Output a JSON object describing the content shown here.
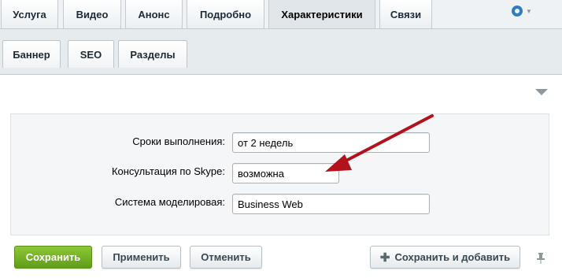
{
  "top_tabs": [
    {
      "label": "Услуга"
    },
    {
      "label": "Видео"
    },
    {
      "label": "Анонс"
    },
    {
      "label": "Подробно"
    },
    {
      "label": "Характеристики",
      "active": true
    },
    {
      "label": "Связи"
    }
  ],
  "sub_tabs": [
    {
      "label": "Баннер"
    },
    {
      "label": "SEO"
    },
    {
      "label": "Разделы"
    }
  ],
  "fields": {
    "deadline": {
      "label": "Сроки выполнения:",
      "value": "от 2 недель"
    },
    "skype": {
      "label": "Консультация по Skype:",
      "value": "возможна"
    },
    "modeling": {
      "label": "Система моделировая:",
      "value": "Business Web"
    }
  },
  "buttons": {
    "save": "Сохранить",
    "apply": "Применить",
    "cancel": "Отменить",
    "save_add": "Сохранить и добавить"
  },
  "icons": {
    "settings": "gear-icon",
    "collapse": "triangle-down-icon",
    "pin": "pin-icon",
    "add": "plus-icon"
  },
  "colors": {
    "accent": "#2e7cc4",
    "save_button": "#72ad25",
    "annotation_arrow": "#b3121c"
  }
}
